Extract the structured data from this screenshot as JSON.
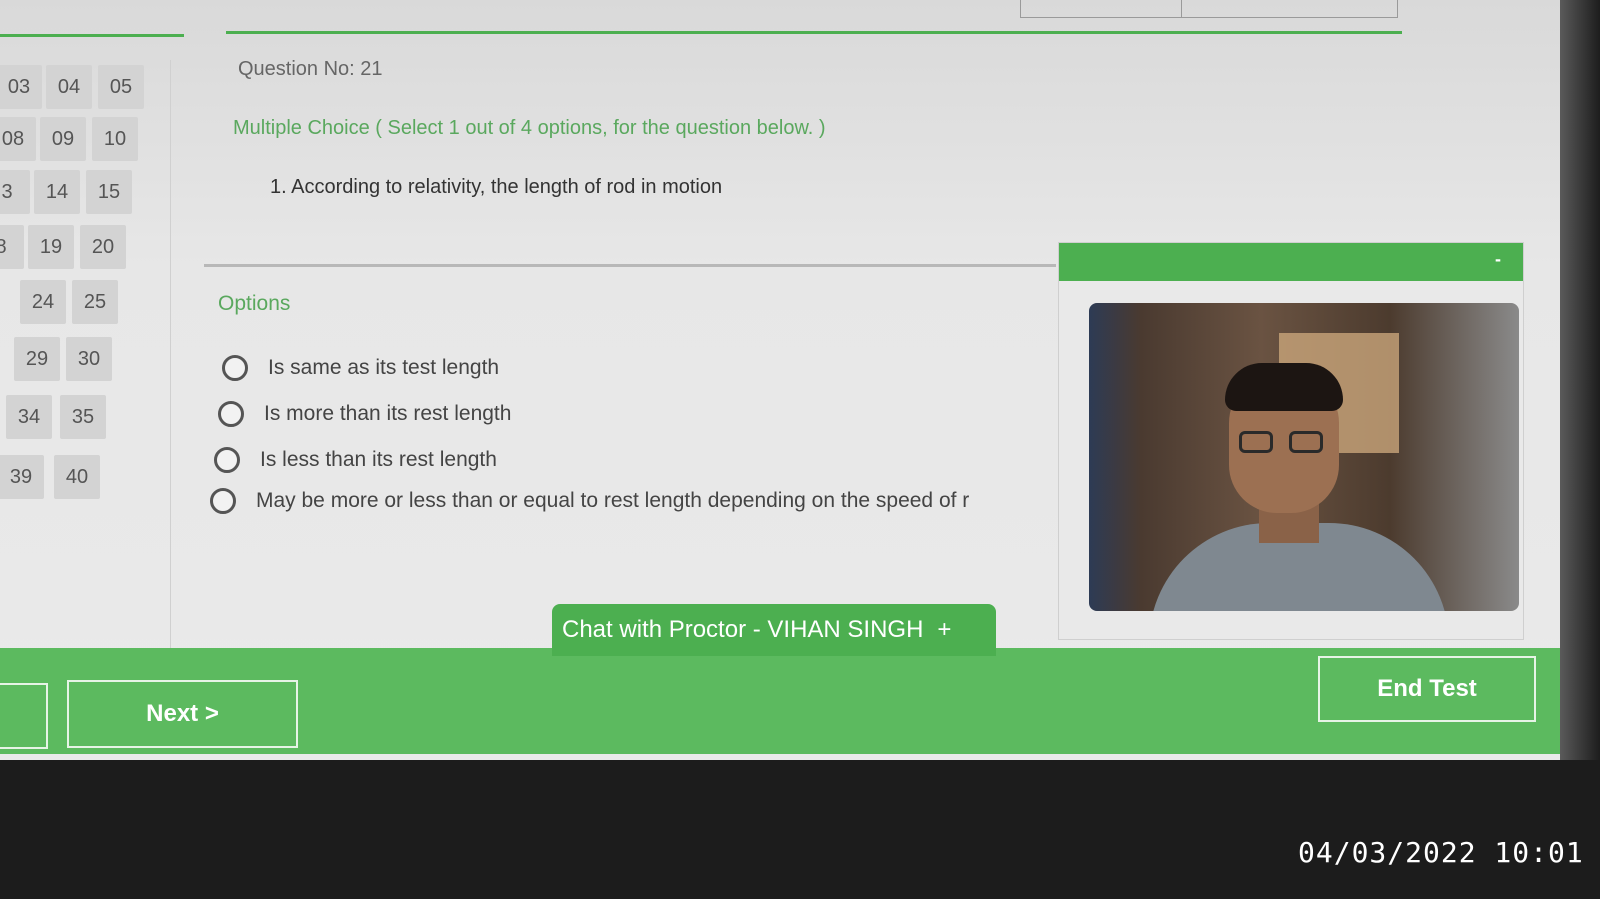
{
  "question": {
    "number_label": "Question No: 21",
    "type_label": "Multiple Choice ( Select 1 out of 4 options, for the question below. )",
    "text": "1. According to relativity, the length of rod in motion"
  },
  "options_label": "Options",
  "options": [
    "Is same as its test length",
    "Is more than its rest length",
    "Is less than its rest length",
    "May be more or less than or equal to rest length depending on the speed of r"
  ],
  "question_grid": [
    "03",
    "04",
    "05",
    "08",
    "09",
    "10",
    "3",
    "14",
    "15",
    "8",
    "19",
    "20",
    "24",
    "25",
    "29",
    "30",
    "34",
    "35",
    "39",
    "40"
  ],
  "video_panel": {
    "minimize_label": "-"
  },
  "chat": {
    "label": "Chat with Proctor - VIHAN SINGH",
    "expand_label": "+"
  },
  "nav": {
    "next_label": "Next >",
    "end_label": "End Test"
  },
  "timestamp": "04/03/2022 10:01",
  "colors": {
    "accent": "#4caf50",
    "bar": "#5cba5f",
    "text": "#444444"
  }
}
